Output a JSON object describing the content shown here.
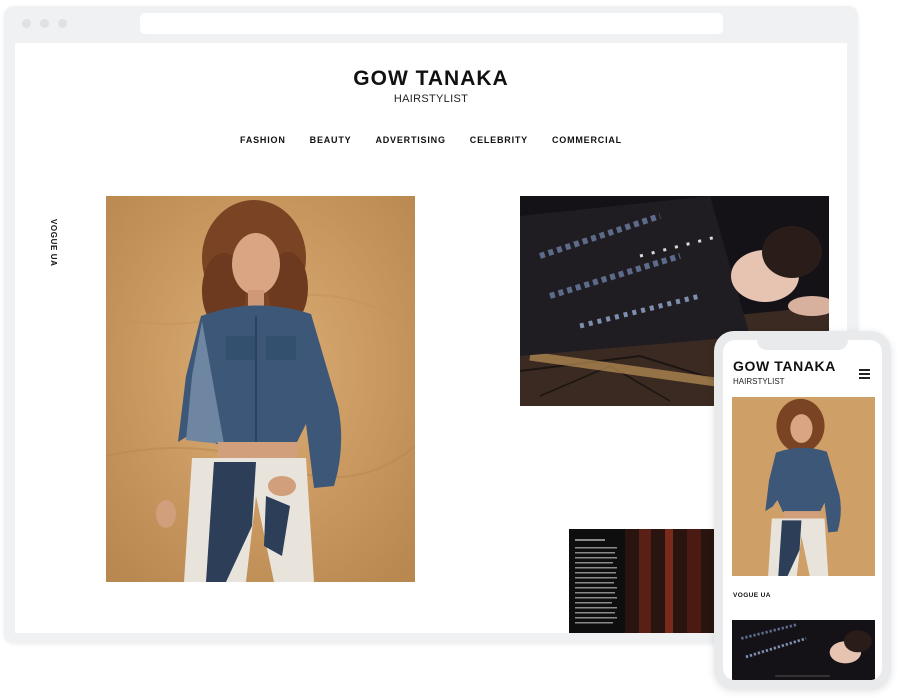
{
  "site": {
    "title": "GOW TANAKA",
    "subtitle": "HAIRSTYLIST"
  },
  "nav": {
    "items": [
      "FASHION",
      "BEAUTY",
      "ADVERTISING",
      "CELEBRITY",
      "COMMERCIAL"
    ]
  },
  "gallery": {
    "caption": "VOGUE UA"
  },
  "mobile": {
    "title": "GOW TANAKA",
    "subtitle": "HAIRSTYLIST",
    "caption": "VOGUE UA",
    "menu_icon": "hamburger-menu-icon"
  },
  "colors": {
    "background": "#ffffff",
    "frame": "#f0f1f3",
    "text": "#111111",
    "photo_warm": "#c99b66",
    "photo_dark": "#151218"
  }
}
